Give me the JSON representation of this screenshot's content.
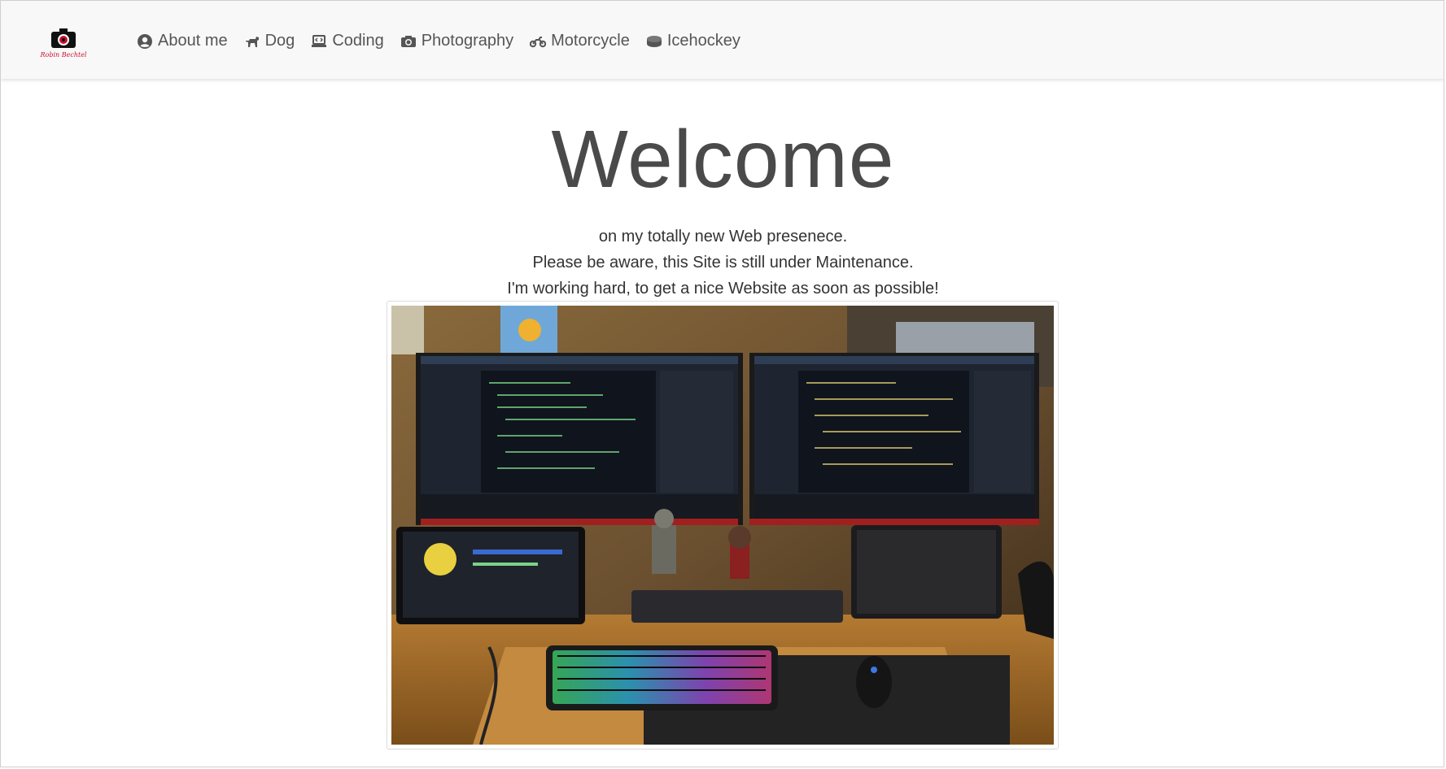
{
  "navbar": {
    "logo_icon": "camera-logo-icon",
    "logo_text": "Robin Bechtel",
    "items": [
      {
        "label": "About me",
        "icon": "user-circle-icon"
      },
      {
        "label": "Dog",
        "icon": "dog-icon"
      },
      {
        "label": "Coding",
        "icon": "laptop-code-icon"
      },
      {
        "label": "Photography",
        "icon": "camera-icon"
      },
      {
        "label": "Motorcycle",
        "icon": "motorcycle-icon"
      },
      {
        "label": "Icehockey",
        "icon": "hockey-puck-icon"
      }
    ]
  },
  "hero": {
    "title": "Welcome",
    "lines": [
      "on my totally new Web presenece.",
      "Please be aware, this Site is still under Maintenance.",
      "I'm working hard, to get a nice Website as soon as possible!"
    ]
  },
  "photo": {
    "description_icon": "desk-setup-photo"
  },
  "colors": {
    "navbar_bg": "#f8f8f8",
    "nav_text": "#555555",
    "title_text": "#4a4a4a",
    "logo_accent": "#c8102e"
  }
}
